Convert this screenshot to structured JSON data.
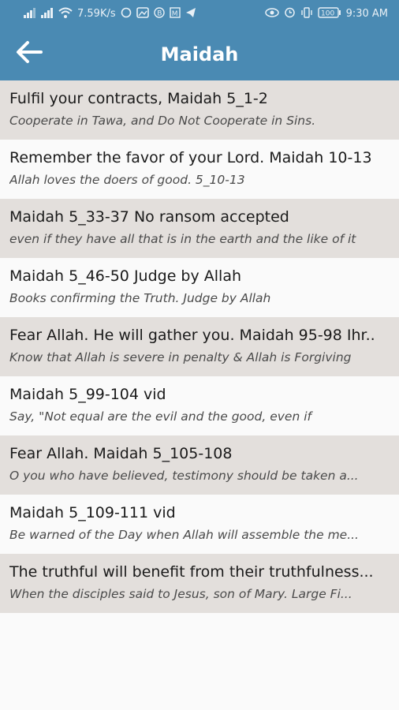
{
  "status": {
    "speed": "7.59K/s",
    "battery": "100",
    "time": "9:30 AM"
  },
  "appbar": {
    "title": "Maidah"
  },
  "items": [
    {
      "title": "Fulfil your contracts, Maidah 5_1-2",
      "subtitle": "Cooperate in Tawa, and Do Not Cooperate in Sins."
    },
    {
      "title": "Remember the favor of your Lord. Maidah 10-13",
      "subtitle": "Allah loves the doers of good. 5_10-13"
    },
    {
      "title": "Maidah 5_33-37 No ransom accepted",
      "subtitle": "even if they have all that is in the earth and the like of it"
    },
    {
      "title": "Maidah 5_46-50 Judge by Allah",
      "subtitle": "Books confirming the Truth. Judge by Allah"
    },
    {
      "title": "Fear Allah. He will gather you. Maidah 95-98 Ihr..",
      "subtitle": "Know that Allah is severe in penalty & Allah is Forgiving"
    },
    {
      "title": "Maidah 5_99-104 vid",
      "subtitle": "Say, \"Not equal are the evil and the good, even if"
    },
    {
      "title": "Fear Allah.  Maidah 5_105-108",
      "subtitle": "O you who have believed, testimony should be taken a..."
    },
    {
      "title": "Maidah 5_109-111 vid",
      "subtitle": "Be warned of the Day when Allah will assemble the me..."
    },
    {
      "title": "The truthful will benefit from their truthfulness...",
      "subtitle": "When the disciples said to Jesus, son of Mary.  Large Fi..."
    }
  ]
}
